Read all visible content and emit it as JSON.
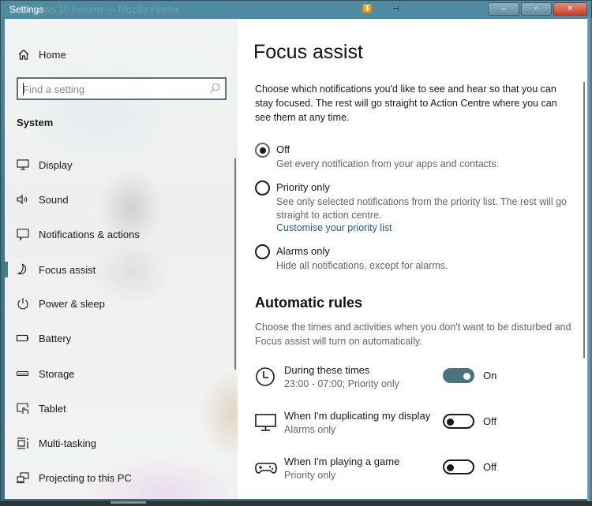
{
  "window": {
    "title": "Settings",
    "background_title_ghost": "ws 10 Forums — Mozilla Firefox",
    "buttons": {
      "minimize": "–",
      "maximize": "▫",
      "close": "✕"
    }
  },
  "sidebar": {
    "home_label": "Home",
    "search_placeholder": "Find a setting",
    "search_value": "",
    "section_label": "System",
    "items": [
      {
        "label": "Display",
        "icon": "monitor-icon",
        "active": false
      },
      {
        "label": "Sound",
        "icon": "speaker-icon",
        "active": false
      },
      {
        "label": "Notifications & actions",
        "icon": "notification-icon",
        "active": false
      },
      {
        "label": "Focus assist",
        "icon": "moon-icon",
        "active": true
      },
      {
        "label": "Power & sleep",
        "icon": "power-icon",
        "active": false
      },
      {
        "label": "Battery",
        "icon": "battery-icon",
        "active": false
      },
      {
        "label": "Storage",
        "icon": "storage-icon",
        "active": false
      },
      {
        "label": "Tablet",
        "icon": "tablet-icon",
        "active": false
      },
      {
        "label": "Multi-tasking",
        "icon": "multitasking-icon",
        "active": false
      },
      {
        "label": "Projecting to this PC",
        "icon": "projecting-icon",
        "active": false
      }
    ]
  },
  "content": {
    "title": "Focus assist",
    "intro": "Choose which notifications you'd like to see and hear so that you can stay focused. The rest will go straight to Action Centre where you can see them at any time.",
    "options": [
      {
        "label": "Off",
        "description": "Get every notification from your apps and contacts.",
        "checked": true
      },
      {
        "label": "Priority only",
        "description": "See only selected notifications from the priority list. The rest will go straight to action centre.",
        "link": "Customise your priority list",
        "checked": false
      },
      {
        "label": "Alarms only",
        "description": "Hide all notifications, except for alarms.",
        "checked": false
      }
    ],
    "automatic_rules": {
      "heading": "Automatic rules",
      "description": "Choose the times and activities when you don't want to be disturbed and Focus assist will turn on automatically.",
      "rules": [
        {
          "title": "During these times",
          "subtitle": "23:00 - 07:00; Priority only",
          "state": "On",
          "on": true,
          "icon": "clock-icon"
        },
        {
          "title": "When I'm duplicating my display",
          "subtitle": "Alarms only",
          "state": "Off",
          "on": false,
          "icon": "monitor-icon"
        },
        {
          "title": "When I'm playing a game",
          "subtitle": "Priority only",
          "state": "Off",
          "on": false,
          "icon": "gamepad-icon"
        }
      ]
    }
  },
  "colors": {
    "accent": "#4a7280",
    "active_bar": "#4a7a8c",
    "link": "#2a5a7c",
    "titlebar": "#3b7b92",
    "close_button": "#c4402a"
  }
}
